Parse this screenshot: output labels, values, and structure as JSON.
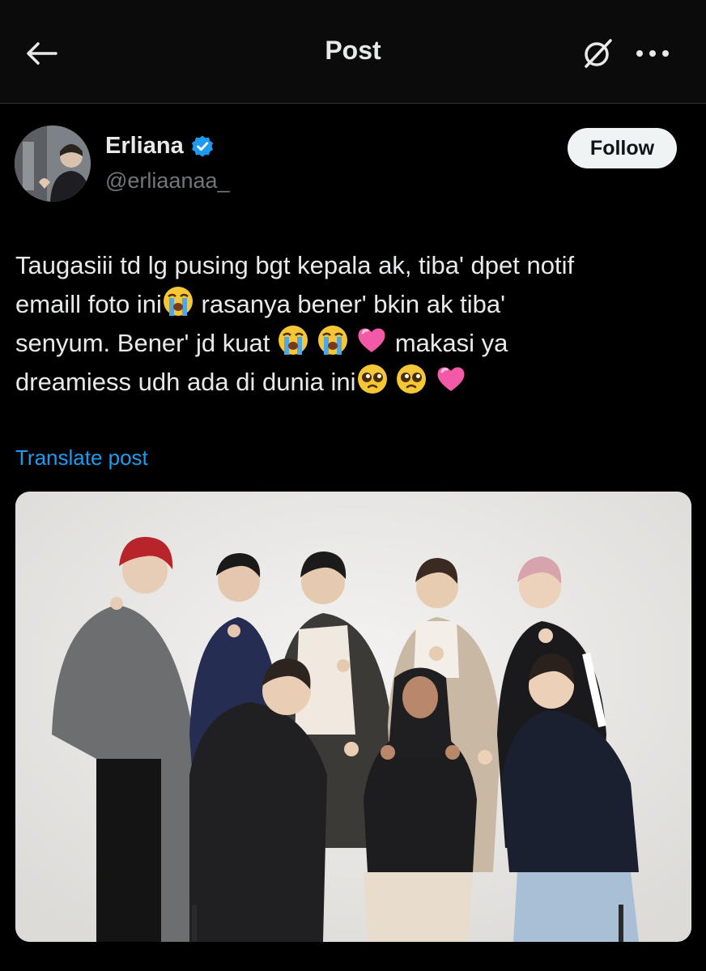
{
  "header": {
    "title": "Post",
    "back_icon": "arrow-left-icon",
    "grok_icon": "grok-icon",
    "more_icon": "more-dots-icon"
  },
  "author": {
    "name": "Erliana",
    "handle": "@erliaanaa_",
    "verified": true,
    "follow_label": "Follow"
  },
  "post": {
    "line1": "Taugasiii td lg pusing bgt kepala ak, tiba' dpet notif",
    "line2_a": "emaill foto ini",
    "line2_b": " rasanya bener' bkin ak tiba'",
    "line3_a": "senyum. Bener' jd kuat ",
    "line3_b": " makasi ya",
    "line4_a": "dreamiess udh ada di dunia ini",
    "translate_label": "Translate post"
  },
  "colors": {
    "background": "#000000",
    "text": "#e7e9ea",
    "secondary_text": "#71767b",
    "link": "#1d9bf0",
    "verified": "#1d9bf0",
    "follow_bg": "#eff3f4"
  }
}
